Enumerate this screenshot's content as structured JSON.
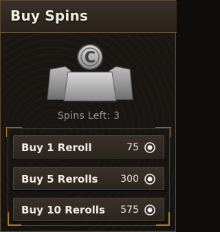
{
  "header": {
    "title": "Buy Spins"
  },
  "hero": {
    "icon": "spin-token-icon",
    "letter": "C"
  },
  "status": {
    "spins_left": "Spins Left: 3"
  },
  "purchase_options": [
    {
      "label": "Buy 1 Reroll",
      "cost": "75"
    },
    {
      "label": "Buy 5 Rerolls",
      "cost": "300"
    },
    {
      "label": "Buy 10 Rerolls",
      "cost": "575"
    }
  ],
  "currency_icon": "coin-icon",
  "colors": {
    "accent_frame": "#b07a2e",
    "header_bg": "#2a221b",
    "text": "#f2ede4"
  }
}
